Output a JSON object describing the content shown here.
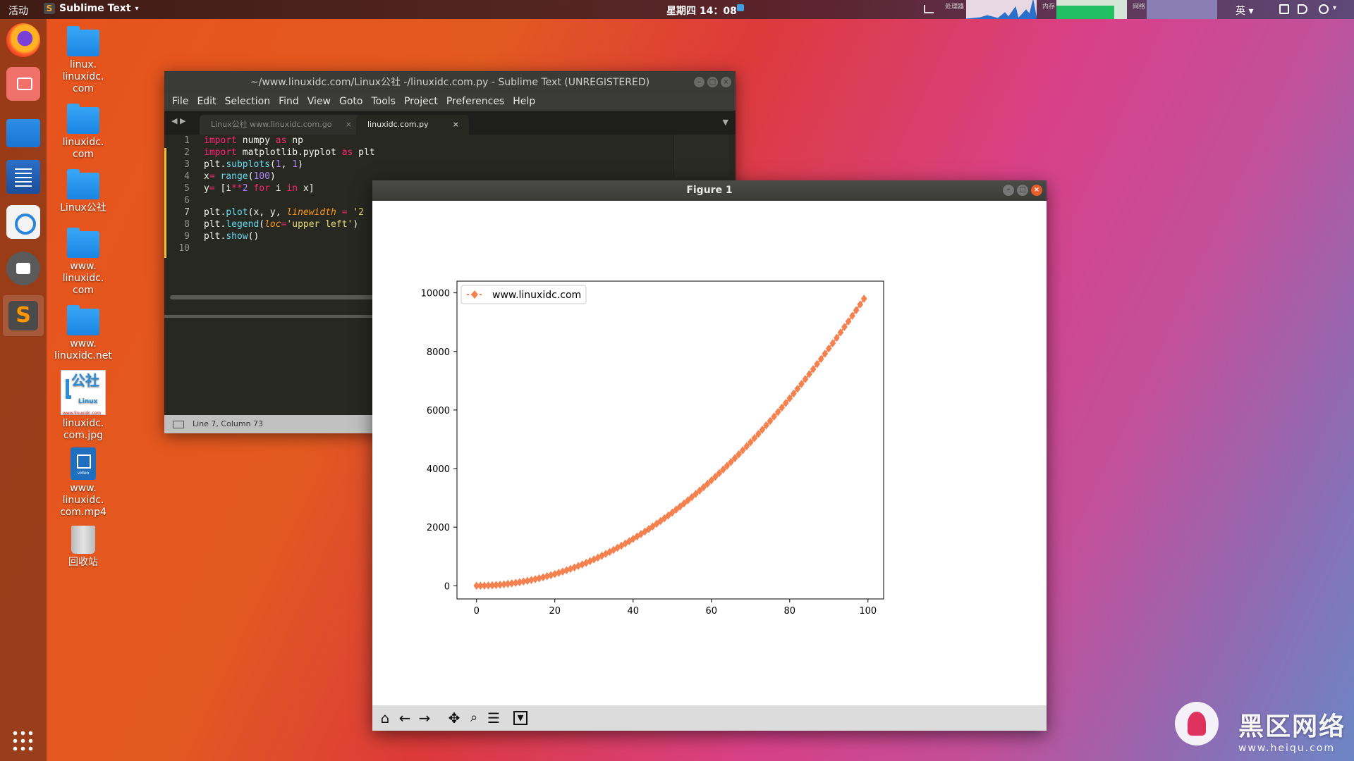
{
  "topbar": {
    "activities": "活动",
    "app_menu": "Sublime Text",
    "clock": "星期四 14：08",
    "cpu_label": "处理器",
    "mem_label": "内存",
    "net_label": "网络",
    "mem_usage": 0.82,
    "input_method": "英"
  },
  "dock": {
    "items": [
      "firefox-icon",
      "screenshot-app-icon",
      "files-icon",
      "writer-icon",
      "software-center-icon",
      "cheese-camera-icon",
      "sublime-text-icon",
      "show-apps-icon"
    ]
  },
  "desktop": {
    "icons": [
      {
        "label": "linux.\nlinuxidc.\ncom"
      },
      {
        "label": "linuxidc.\ncom"
      },
      {
        "label": "Linux公社"
      },
      {
        "label": "www.\nlinuxidc.\ncom"
      },
      {
        "label": "www.\nlinuxidc.net"
      },
      {
        "label": "linuxidc.\ncom.jpg"
      },
      {
        "label": "www.\nlinuxidc.\ncom.mp4"
      },
      {
        "label": "回收站"
      }
    ],
    "jpg_thumb": {
      "title": "公社",
      "sub": "Linux",
      "url": "www.linuxidc.com"
    },
    "mp4_thumb_label": "video"
  },
  "sublime": {
    "title": "~/www.linuxidc.com/Linux公社 -/linuxidc.com.py - Sublime Text (UNREGISTERED)",
    "menu": [
      "File",
      "Edit",
      "Selection",
      "Find",
      "View",
      "Goto",
      "Tools",
      "Project",
      "Preferences",
      "Help"
    ],
    "tabs": [
      "Linux公社 www.linuxidc.com.go",
      "linuxidc.com.py"
    ],
    "tab_close": "×",
    "status": "Line 7, Column 73",
    "line_numbers": [
      "1",
      "2",
      "3",
      "4",
      "5",
      "6",
      "7",
      "8",
      "9",
      "10"
    ]
  },
  "figure": {
    "title": "Figure 1",
    "toolbar": [
      "home-icon",
      "back-icon",
      "forward-icon",
      "pan-icon",
      "zoom-icon",
      "subplots-icon",
      "save-icon"
    ]
  },
  "chart_data": {
    "type": "line",
    "series": [
      {
        "name": "www.linuxidc.com",
        "color": "#f5814f",
        "marker": "diamond",
        "formula": "y = x^2",
        "x_start": 0,
        "x_end": 99,
        "x_step": 1
      }
    ],
    "xlim": [
      -5,
      104
    ],
    "ylim": [
      -450,
      10400
    ],
    "xticks": [
      0,
      20,
      40,
      60,
      80,
      100
    ],
    "yticks": [
      0,
      2000,
      4000,
      6000,
      8000,
      10000
    ],
    "legend": "upper left",
    "grid": false
  },
  "watermark": {
    "text": "黑区网络",
    "url": "www.heiqu.com"
  }
}
